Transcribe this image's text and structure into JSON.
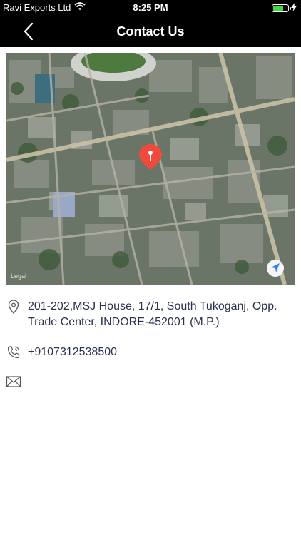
{
  "status_bar": {
    "carrier": "Ravi Exports Ltd",
    "time": "8:25 PM",
    "battery_color": "#3ddc3d"
  },
  "header": {
    "title": "Contact Us",
    "back_icon": "chevron-left-icon"
  },
  "map": {
    "type": "satellite",
    "pin_color": "#f04a3c",
    "legal_label": "Legal"
  },
  "contact": {
    "address": "201-202,MSJ House, 17/1, South Tukoganj, Opp. Trade Center, INDORE-452001 (M.P.)",
    "phone": "+9107312538500",
    "email": ""
  },
  "icons": {
    "address": "location-pin-icon",
    "phone": "phone-icon",
    "email": "envelope-icon",
    "locate": "navigation-arrow-icon"
  }
}
